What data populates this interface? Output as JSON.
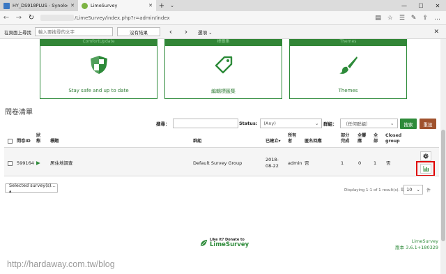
{
  "browser": {
    "tabs": [
      {
        "title": "HY_DS918PLUS - Synology I",
        "active": false
      },
      {
        "title": "LimeSurvey",
        "active": true
      }
    ],
    "new_tab": "+",
    "tab_more": "⌄",
    "url": "/LimeSurvey/index.php?r=admin/index",
    "window_controls": [
      "—",
      "☐",
      "✕"
    ]
  },
  "findbar": {
    "label": "在頁面上尋找",
    "placeholder": "輸入要搜尋的文字",
    "result": "沒有結果",
    "prev": "‹",
    "next": "›",
    "options": "選項 ⌄",
    "close": "✕"
  },
  "cards": [
    {
      "header": "ComfortUpdate",
      "description": "Stay safe and up to date",
      "icon": "shield-icon"
    },
    {
      "header": "標籤集",
      "description": "編輯標籤集",
      "icon": "tag-icon"
    },
    {
      "header": "Themes",
      "description": "Themes",
      "icon": "brush-icon"
    }
  ],
  "page_title": "問卷清單",
  "filters": {
    "search_label": "搜尋：",
    "search_value": "",
    "status_label": "Status:",
    "status_value": "(Any)",
    "group_label": "群組：",
    "group_value": "（任何群組）",
    "search_button": "搜索",
    "reset_button": "重設"
  },
  "table": {
    "headers": {
      "id": "問卷ID",
      "status": "狀態",
      "title": "標題",
      "group": "群組",
      "created": "已建立▾",
      "owner": "所有者",
      "anonymous": "匿名回應",
      "partial": "部分完成",
      "full": "全響應",
      "total": "全部",
      "closed_group": "Closed group"
    },
    "rows": [
      {
        "id": "599164",
        "status": "▶",
        "title": "居住地調查",
        "group": "Default Survey Group",
        "created": "2018-08-22",
        "owner": "admin",
        "anonymous": "否",
        "partial": "1",
        "full": "0",
        "total": "1",
        "closed_group": "否"
      }
    ]
  },
  "selected_button": "Selected survey(s)... ▴",
  "pagination": {
    "summary": "Displaying 1-1 of 1 result(s). 每頁",
    "page_size": "10",
    "unit": "件"
  },
  "footer": {
    "logo_line1": "Like it? Donate to",
    "logo_line2": "LimeSurvey",
    "product": "LimeSurvey",
    "version": "版本 3.6.1+180329"
  },
  "watermark": "http://hardaway.com.tw/blog",
  "colors": {
    "brand_green": "#328637",
    "reset_brown": "#a0522d",
    "highlight_red": "#e00000"
  }
}
